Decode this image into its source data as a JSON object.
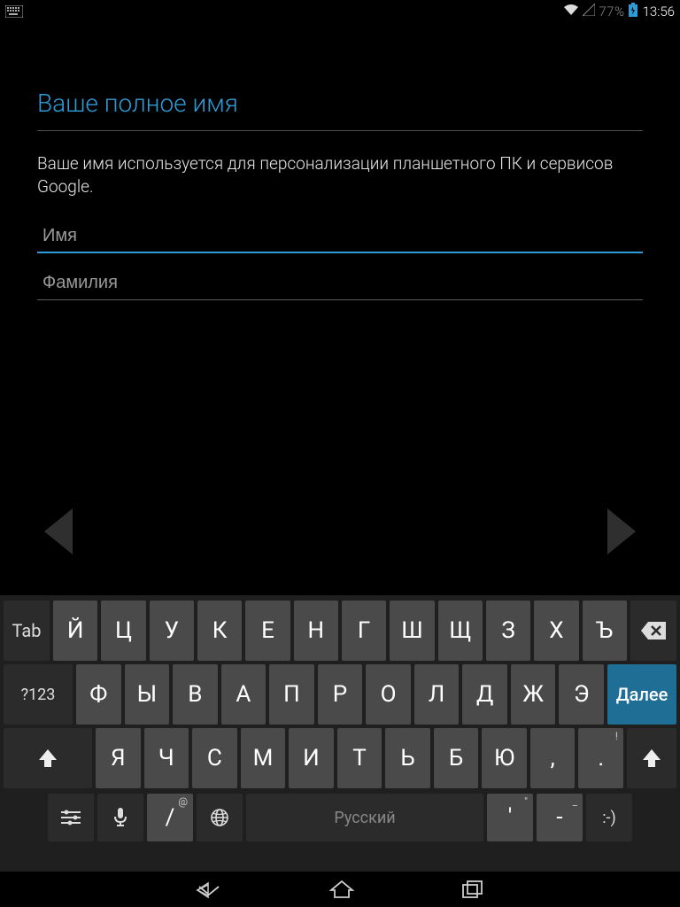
{
  "status": {
    "battery_pct": "77%",
    "clock": "13:56"
  },
  "content": {
    "title": "Ваше полное имя",
    "subtitle": "Ваше имя используется для персонализации планшетного ПК и сервисов Google.",
    "first_name_placeholder": "Имя",
    "first_name_value": "",
    "last_name_placeholder": "Фамилия",
    "last_name_value": ""
  },
  "keyboard": {
    "tab": "Tab",
    "sym": "?123",
    "next": "Далее",
    "space": "Русский",
    "row1": [
      "Й",
      "Ц",
      "У",
      "К",
      "Е",
      "Н",
      "Г",
      "Ш",
      "Щ",
      "З",
      "Х",
      "Ъ"
    ],
    "row2": [
      "Ф",
      "Ы",
      "В",
      "А",
      "П",
      "Р",
      "О",
      "Л",
      "Д",
      "Ж",
      "Э"
    ],
    "row3": [
      "Я",
      "Ч",
      "С",
      "М",
      "И",
      "Т",
      "Ь",
      "Б",
      "Ю",
      ",",
      "."
    ],
    "row4": {
      "slash": "/",
      "slash_sup": "@",
      "quote": "'",
      "quote_sup": "\"",
      "dash": "-",
      "dash_sup": "_",
      "smile": ":-)",
      "period_sup": "!"
    }
  }
}
